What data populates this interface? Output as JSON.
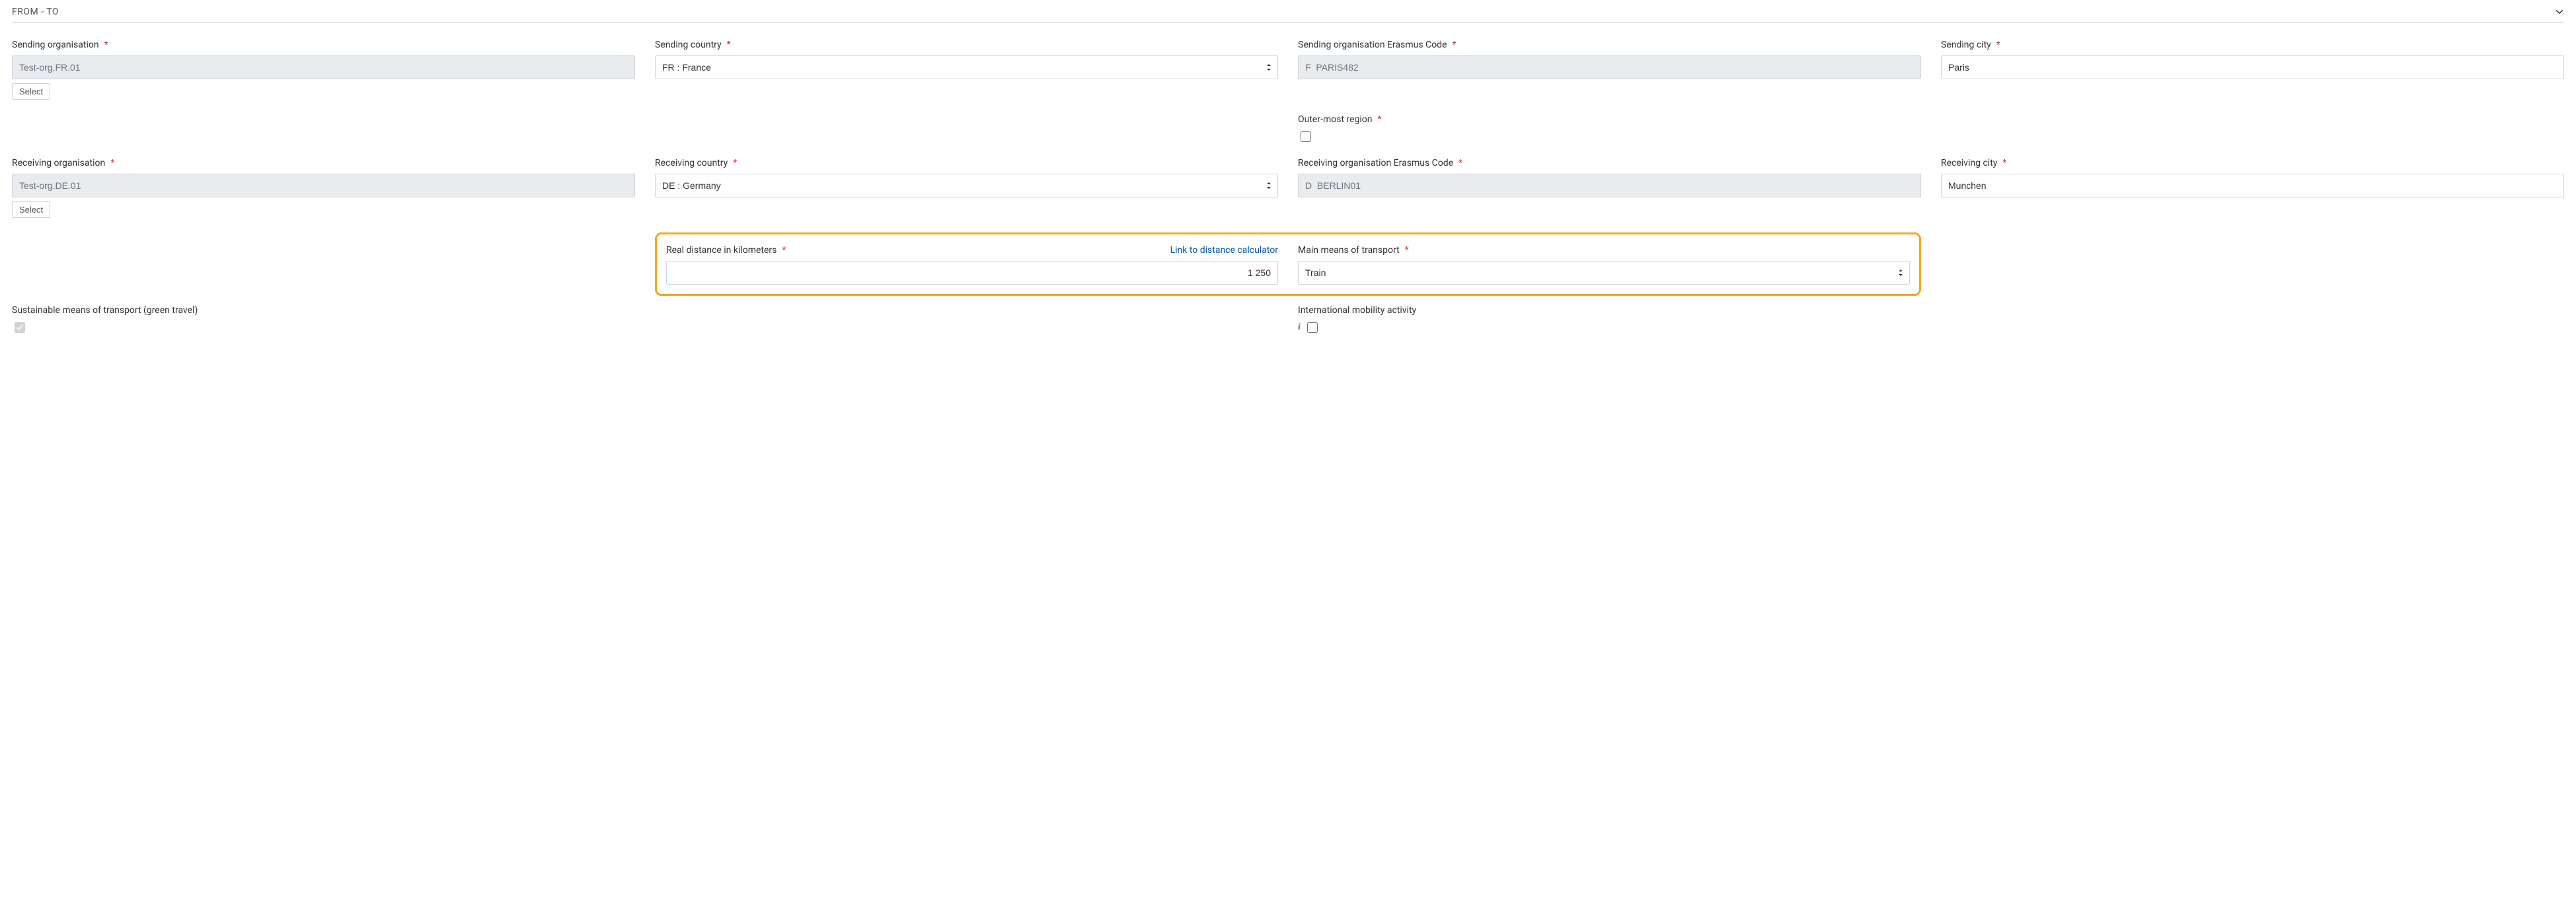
{
  "section": {
    "title": "FROM - TO"
  },
  "labels": {
    "sendingOrg": "Sending organisation",
    "sendingCountry": "Sending country",
    "sendingErasmus": "Sending organisation Erasmus Code",
    "sendingCity": "Sending city",
    "outerRegion": "Outer-most region",
    "receivingOrg": "Receiving organisation",
    "receivingCountry": "Receiving country",
    "receivingErasmus": "Receiving organisation Erasmus Code",
    "receivingCity": "Receiving city",
    "distance": "Real distance in kilometers",
    "distanceLink": "Link to distance calculator",
    "transport": "Main means of transport",
    "greenTravel": "Sustainable means of transport (green travel)",
    "intlMobility": "International mobility activity"
  },
  "buttons": {
    "select": "Select"
  },
  "values": {
    "sendingOrg": "Test-org.FR.01",
    "sendingCountry": "FR : France",
    "sendingErasmus": "F  PARIS482",
    "sendingCity": "Paris",
    "outerRegion": false,
    "receivingOrg": "Test-org.DE.01",
    "receivingCountry": "DE : Germany",
    "receivingErasmus": "D  BERLIN01",
    "receivingCity": "Munchen",
    "distance": "1 250",
    "transport": "Train",
    "greenTravel": true,
    "intlMobility": false
  }
}
